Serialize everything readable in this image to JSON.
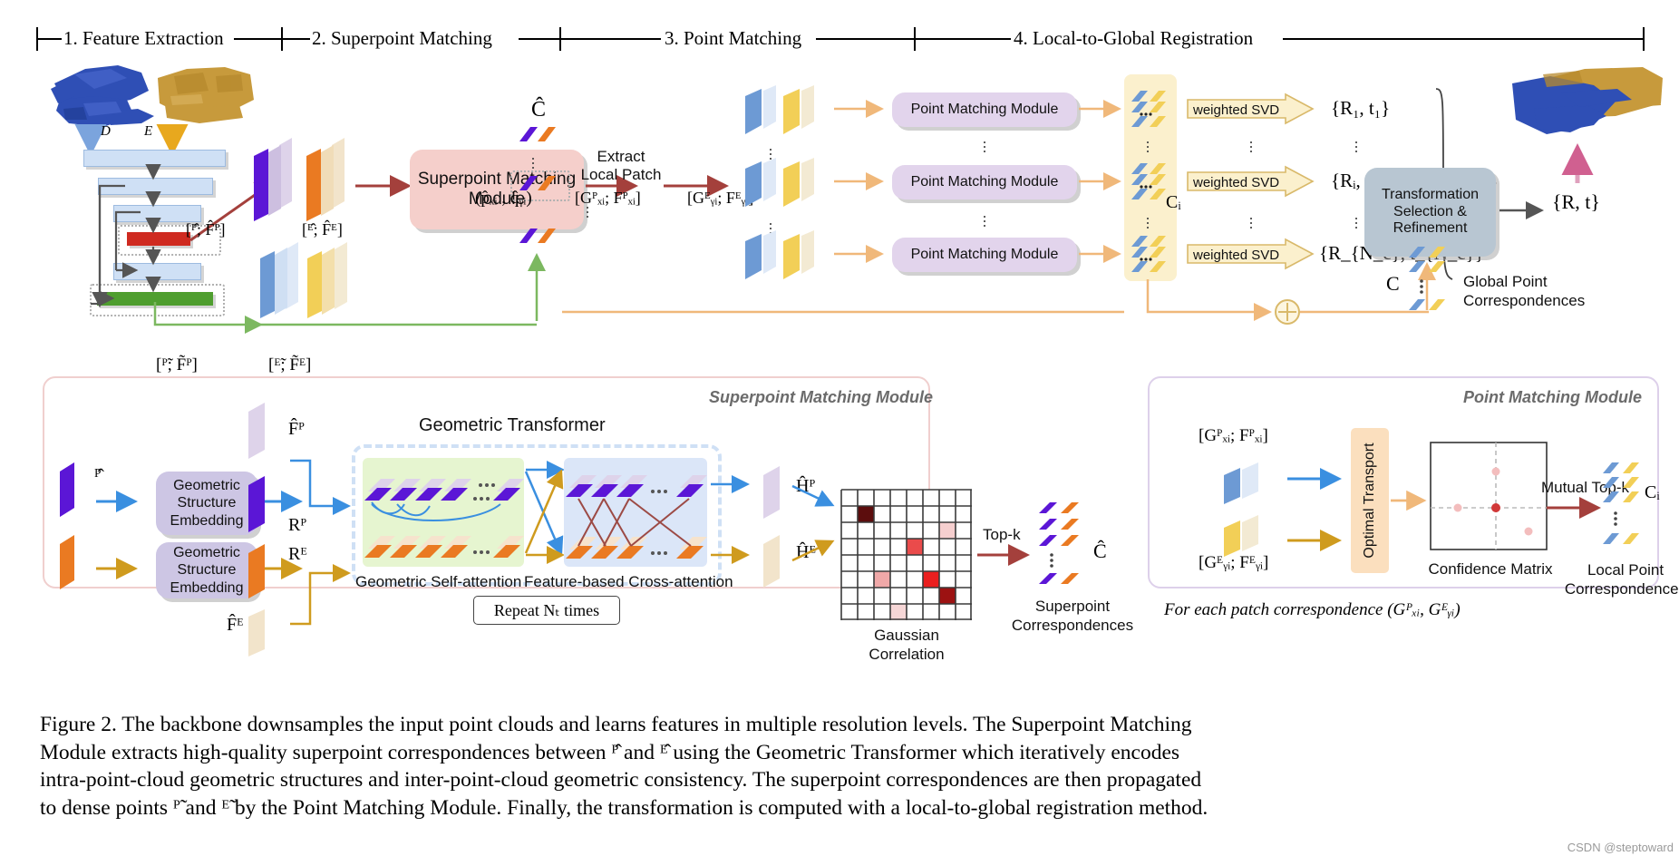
{
  "figure": {
    "stages": [
      {
        "id": "s1",
        "label": "1. Feature Extraction"
      },
      {
        "id": "s2",
        "label": "2. Superpoint Matching"
      },
      {
        "id": "s3",
        "label": "3. Point Matching"
      },
      {
        "id": "s4",
        "label": "4. Local-to-Global Registration"
      }
    ],
    "pipeline": {
      "input_p_label": "ᴰ",
      "input_q_label": "ᴱ",
      "superpoint_features_p": "[ᴾ̂; F̂ᴾ]",
      "superpoint_features_q": "[ᴱ̂; F̂ᴱ]",
      "dense_features_p": "[ᴾ̃; F̃ᴾ]",
      "dense_features_q": "[ᴱ̃; F̃ᴱ]",
      "smm_label": "Superpoint Matching Module",
      "correspondence_pair": "(p̂ₓᵢ , q̂ᵧᵢ)",
      "c_hat_label": "Ĉ",
      "extract_local_patch": "Extract\nLocal Patch",
      "extract_line1": "Extract",
      "extract_line2": "Local Patch",
      "patch_p_label": "[Gᴾₓᵢ; Fᴾₓᵢ]",
      "patch_q_label": "[Gᴱᵧᵢ; Fᴱᵧᵢ]",
      "pmm_label": "Point Matching Module",
      "ci_label": "Cᵢ",
      "weighted_svd_label": "weighted SVD",
      "transforms": [
        "{R₁, t₁}",
        "{Rᵢ, tᵢ}",
        "{R_{N_c}, t_{N_c}}"
      ],
      "tsr_label": "Transformation\nSelection &\nRefinement",
      "tsr_line1": "Transformation",
      "tsr_line2": "Selection &",
      "tsr_line3": "Refinement",
      "final_transform": "{R, t}",
      "global_c_label": "C",
      "global_point_corr_line1": "Global Point",
      "global_point_corr_line2": "Correspondences"
    },
    "superpoint_panel": {
      "title": "Superpoint Matching Module",
      "gse_label": "Geometric\nStructure\nEmbedding",
      "gse_line1": "Geometric",
      "gse_line2": "Structure",
      "gse_line3": "Embedding",
      "input_p": "ᴾ̂",
      "input_q": "ᴱ̂",
      "feat_p": "F̂ᴾ",
      "feat_q": "F̂ᴱ",
      "rp": "Rᴾ",
      "rq": "Rᴱ",
      "transformer_title": "Geometric Transformer",
      "self_attention_label": "Geometric Self-attention",
      "cross_attention_label": "Feature-based Cross-attention",
      "repeat_label": "Repeat Nₜ times",
      "hp": "Ĥᴾ",
      "hq": "Ĥᴱ",
      "gaussian_line1": "Gaussian",
      "gaussian_line2": "Correlation",
      "topk_label": "Top-k",
      "c_hat": "Ĉ",
      "superpoint_corr_line1": "Superpoint",
      "superpoint_corr_line2": "Correspondences"
    },
    "point_panel": {
      "title": "Point Matching Module",
      "patch_p": "[Gᴾₓᵢ; Fᴾₓᵢ]",
      "patch_q": "[Gᴱᵧᵢ; Fᴱᵧᵢ]",
      "optimal_transport": "Optimal Transport",
      "confidence_matrix": "Confidence Matrix",
      "mutual_topk": "Mutual Top-k",
      "ci": "Cᵢ",
      "local_corr_line1": "Local Point",
      "local_corr_line2": "Correspondences",
      "footnote": "For each patch correspondence (Gᴾₓᵢ, Gᴱᵧᵢ)"
    },
    "caption": {
      "line1": "Figure 2.  The backbone downsamples the input point clouds and learns features in multiple resolution levels.  The Superpoint Matching",
      "line2": "Module extracts high-quality superpoint correspondences between ᴾ̂ and ᴱ̂ using the Geometric Transformer which iteratively encodes",
      "line3": "intra-point-cloud geometric structures and inter-point-cloud geometric consistency.  The superpoint correspondences are then propagated",
      "line4": "to dense points ᴾ̃ and ᴱ̃ by the Point Matching Module.  Finally, the transformation is computed with a local-to-global registration method."
    },
    "watermark": "CSDN @steptoward",
    "colors": {
      "purple": "#5b16d6",
      "orange": "#ea7a22",
      "blue_point_cloud": "#2f4fb5",
      "gold_point_cloud": "#c79a3c",
      "smm_pink": "#f5cfcb",
      "pmm_lavender": "#e2d4ec",
      "tsr_gray_blue": "#b8c6d2",
      "cream_band": "#fbf0cd",
      "self_attn_green": "#e6f5d0",
      "cross_attn_blue": "#dbe6f8",
      "optimal_transport_peach": "#fbdfbe",
      "arrow_red": "#a4403c",
      "arrow_orange": "#f0b87a",
      "arrow_blue": "#3a8fe0",
      "arrow_gold": "#cf9b1e",
      "arrow_green": "#7cb860",
      "arrow_gray": "#555555",
      "arrow_pink": "#d06090",
      "encoder_bar": "#cfe0f5",
      "red_bar": "#cf2a20",
      "green_bar": "#4f9e2f"
    }
  }
}
